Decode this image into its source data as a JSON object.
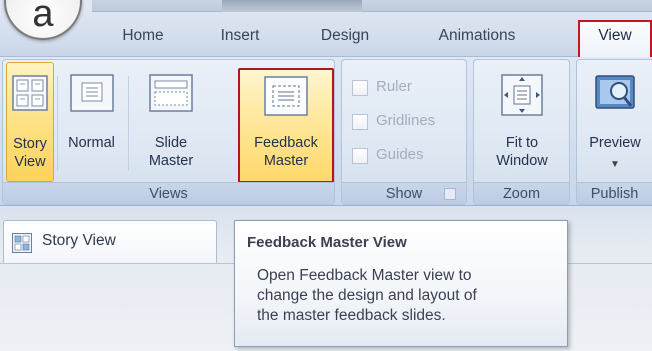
{
  "app": {
    "orb_letter": "a"
  },
  "tabs": [
    {
      "label": "Home"
    },
    {
      "label": "Insert"
    },
    {
      "label": "Design"
    },
    {
      "label": "Animations"
    },
    {
      "label": "View",
      "active": true
    }
  ],
  "ribbon": {
    "views": {
      "label": "Views",
      "story_view": "Story\nView",
      "normal": "Normal",
      "slide_master": "Slide\nMaster",
      "feedback_master": "Feedback\nMaster"
    },
    "show": {
      "label": "Show",
      "items": [
        {
          "label": "Ruler",
          "checked": false
        },
        {
          "label": "Gridlines",
          "checked": false
        },
        {
          "label": "Guides",
          "checked": false
        }
      ]
    },
    "zoom": {
      "label": "Zoom",
      "fit_to_window": "Fit to\nWindow"
    },
    "publish": {
      "label": "Publish",
      "preview": "Preview"
    }
  },
  "document": {
    "tab_label": "Story View"
  },
  "tooltip": {
    "title": "Feedback Master View",
    "body": "Open Feedback Master view to\nchange the design and layout of\nthe master feedback slides."
  },
  "colors": {
    "highlight_border": "#c4161c",
    "active_button": "#ffe38a",
    "ribbon_bg": "#dce6f2"
  }
}
